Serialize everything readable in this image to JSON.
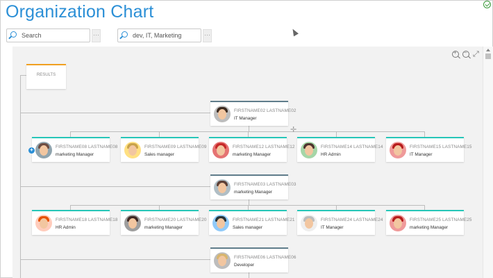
{
  "app": {
    "title": "Organization Chart"
  },
  "search": {
    "value": "Search"
  },
  "filter": {
    "value": "dev, IT, Marketing"
  },
  "more_label": "···",
  "results_label": "RESULTS",
  "toolbar": {
    "zoom_in": "zoom-in-icon",
    "zoom_out": "zoom-out-icon",
    "fullscreen": "fullscreen-icon"
  },
  "colors": {
    "title": "#2b8fd6",
    "manager_bar": "#607d8b",
    "staff_bar": "#26c6b8",
    "results_bar": "#f0a020"
  },
  "people": [
    {
      "id": "it-manager-02",
      "name": "FIRSTNAME02 LASTNAME02",
      "role": "IT Manager",
      "bg": "#bdbdbd",
      "hair": "#3b2a20"
    },
    {
      "id": "p08",
      "name": "FIRSTNAME08 LASTNAME08",
      "role": "marketing Manager",
      "bg": "#90a4ae",
      "hair": "#6d4c41"
    },
    {
      "id": "p09",
      "name": "FIRSTNAME09 LASTNAME09",
      "role": "Sales manager",
      "bg": "#ffe082",
      "hair": "#c8a24a"
    },
    {
      "id": "p12",
      "name": "FIRSTNAME12 LASTNAME12",
      "role": "marketing Manager",
      "bg": "#e57373",
      "hair": "#c62828"
    },
    {
      "id": "p14",
      "name": "FIRSTNAME14 LASTNAME14",
      "role": "HR Admin",
      "bg": "#a5d6a7",
      "hair": "#4e342e"
    },
    {
      "id": "p15",
      "name": "FIRSTNAME15 LASTNAME15",
      "role": "IT Manager",
      "bg": "#ef9a9a",
      "hair": "#b71c1c"
    },
    {
      "id": "marketing-manager-03",
      "name": "FIRSTNAME03 LASTNAME03",
      "role": "marketing Manager",
      "bg": "#b0bec5",
      "hair": "#5d4037"
    },
    {
      "id": "p18",
      "name": "FIRSTNAME18 LASTNAME18",
      "role": "HR Admin",
      "bg": "#ffccbc",
      "hair": "#e65100"
    },
    {
      "id": "p20",
      "name": "FIRSTNAME20 LASTNAME20",
      "role": "marketing Manager",
      "bg": "#9e9e9e",
      "hair": "#3e2723"
    },
    {
      "id": "p21",
      "name": "FIRSTNAME21 LASTNAME21",
      "role": "Sales manager",
      "bg": "#90caf9",
      "hair": "#263238"
    },
    {
      "id": "p24",
      "name": "FIRSTNAME24 LASTNAME24",
      "role": "IT Manager",
      "bg": "#eeeeee",
      "hair": "#bdbdbd"
    },
    {
      "id": "p25",
      "name": "FIRSTNAME25 LASTNAME25",
      "role": "marketing Manager",
      "bg": "#ef9a9a",
      "hair": "#b71c1c"
    },
    {
      "id": "developer-06",
      "name": "FIRSTNAME06 LASTNAME06",
      "role": "Developer",
      "bg": "#bdbdbd",
      "hair": "#d7b56d"
    }
  ]
}
